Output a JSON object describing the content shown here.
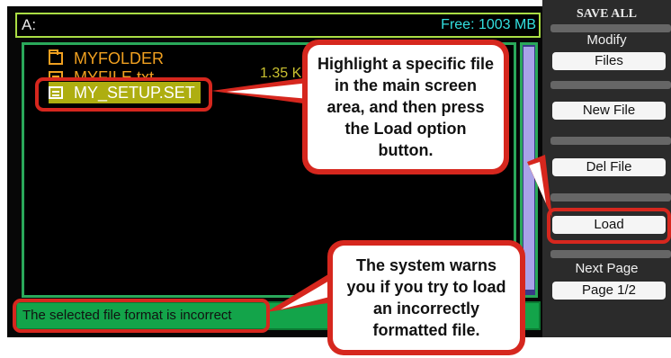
{
  "screen": {
    "path": "A:",
    "free_space": "Free: 1003 MB",
    "files": [
      {
        "name": "MYFOLDER",
        "icon": "folder-icon"
      },
      {
        "name": "MYFILE.txt",
        "icon": "file-icon",
        "size": "1.35 K"
      },
      {
        "name": "MY_SETUP.SET",
        "icon": "file-icon",
        "selected": true
      }
    ],
    "status": "The selected file format is incorrect"
  },
  "menu": {
    "title": "SAVE ALL",
    "modify_label": "Modify",
    "files_button": "Files",
    "new_file_button": "New File",
    "del_file_button": "Del File",
    "load_button": "Load",
    "next_page_label": "Next Page",
    "page_button": "Page 1/2"
  },
  "callouts": {
    "top": "Highlight a specific file in the main screen area, and then press the Load option button.",
    "bottom": "The system warns you if you try to load an incorrectly formatted file."
  },
  "colors": {
    "callout_red": "#d6271e",
    "status_green": "#13a44a",
    "selection": "#aeae10",
    "file_orange": "#f0a020",
    "free_cyan": "#33e0e0"
  }
}
